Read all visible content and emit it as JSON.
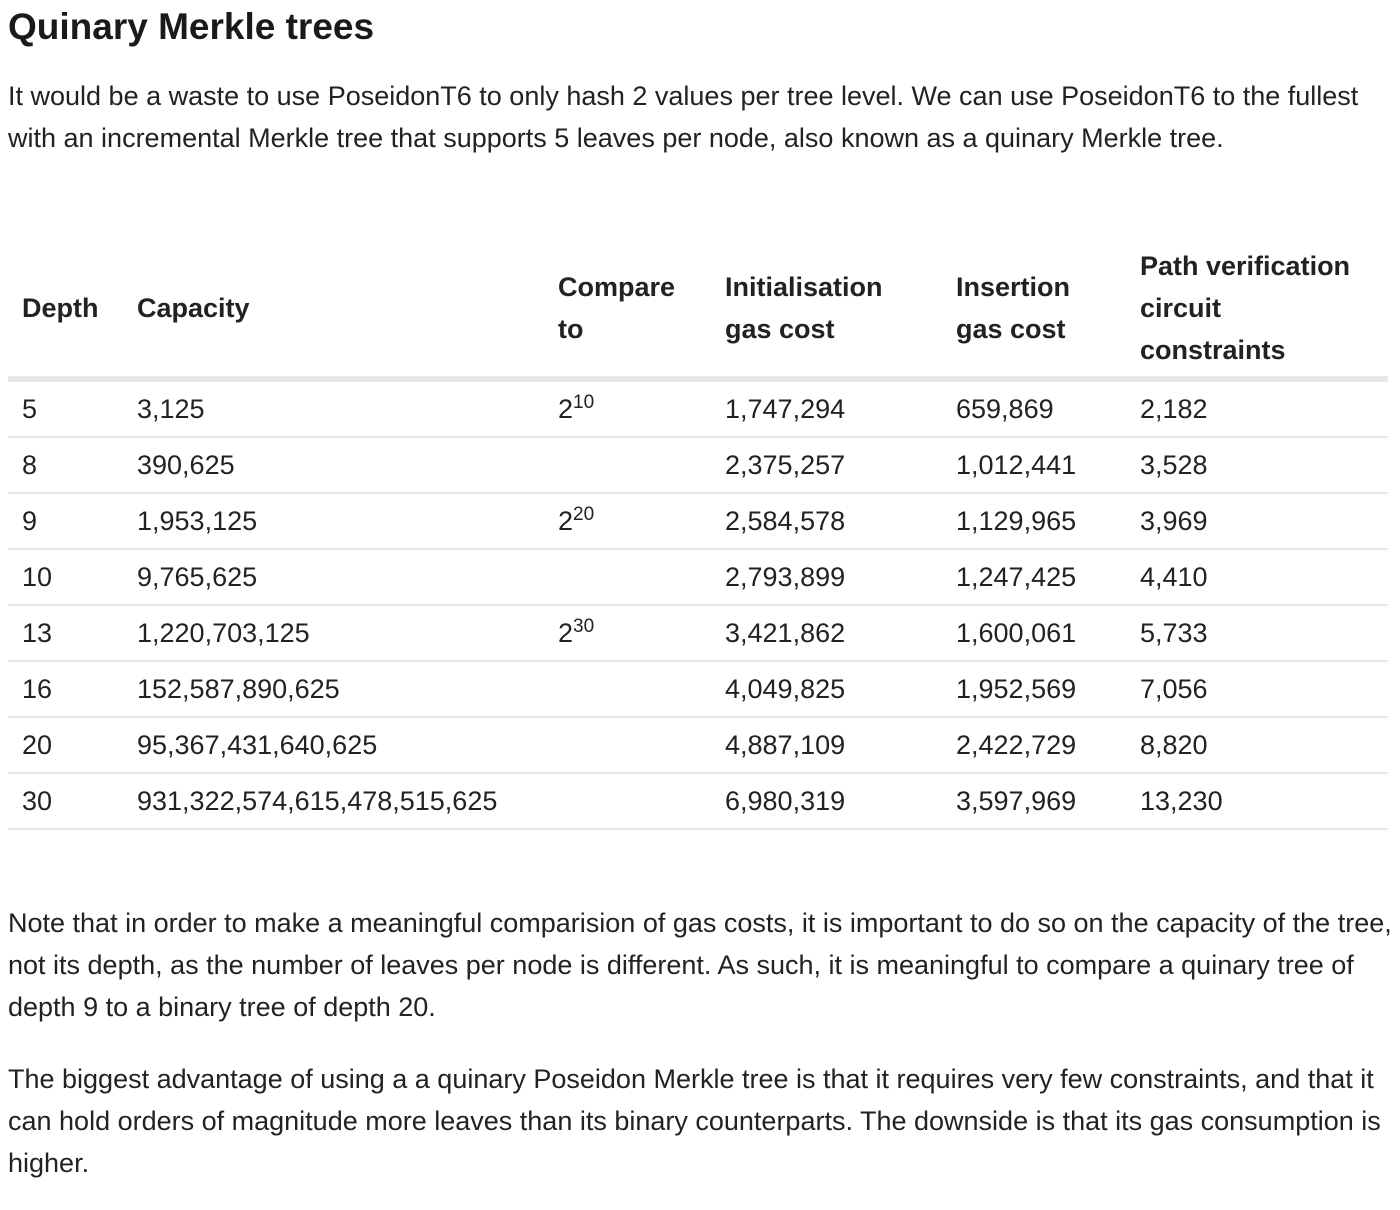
{
  "heading": "Quinary Merkle trees",
  "intro": "It would be a waste to use PoseidonT6 to only hash 2 values per tree level. We can use PoseidonT6 to the fullest with an incremental Merkle tree that supports 5 leaves per node, also known as a quinary Merkle tree.",
  "table": {
    "headers": {
      "depth": "Depth",
      "capacity": "Capacity",
      "compare": "Compare to",
      "init_gas": "Initialisation gas cost",
      "insert_gas": "Insertion gas cost",
      "path_constraints": "Path verification circuit constraints"
    },
    "rows": [
      {
        "depth": "5",
        "capacity": "3,125",
        "compare_base": "2",
        "compare_exp": "10",
        "init_gas": "1,747,294",
        "insert_gas": "659,869",
        "constraints": "2,182"
      },
      {
        "depth": "8",
        "capacity": "390,625",
        "compare_base": "",
        "compare_exp": "",
        "init_gas": "2,375,257",
        "insert_gas": "1,012,441",
        "constraints": "3,528"
      },
      {
        "depth": "9",
        "capacity": "1,953,125",
        "compare_base": "2",
        "compare_exp": "20",
        "init_gas": "2,584,578",
        "insert_gas": "1,129,965",
        "constraints": "3,969"
      },
      {
        "depth": "10",
        "capacity": "9,765,625",
        "compare_base": "",
        "compare_exp": "",
        "init_gas": "2,793,899",
        "insert_gas": "1,247,425",
        "constraints": "4,410"
      },
      {
        "depth": "13",
        "capacity": "1,220,703,125",
        "compare_base": "2",
        "compare_exp": "30",
        "init_gas": "3,421,862",
        "insert_gas": "1,600,061",
        "constraints": "5,733"
      },
      {
        "depth": "16",
        "capacity": "152,587,890,625",
        "compare_base": "",
        "compare_exp": "",
        "init_gas": "4,049,825",
        "insert_gas": "1,952,569",
        "constraints": "7,056"
      },
      {
        "depth": "20",
        "capacity": "95,367,431,640,625",
        "compare_base": "",
        "compare_exp": "",
        "init_gas": "4,887,109",
        "insert_gas": "2,422,729",
        "constraints": "8,820"
      },
      {
        "depth": "30",
        "capacity": "931,322,574,615,478,515,625",
        "compare_base": "",
        "compare_exp": "",
        "init_gas": "6,980,319",
        "insert_gas": "3,597,969",
        "constraints": "13,230"
      }
    ]
  },
  "note1": "Note that in order to make a meaningful comparision of gas costs, it is important to do so on the capacity of the tree, not its depth, as the number of leaves per node is different. As such, it is meaningful to compare a quinary tree of depth 9 to a binary tree of depth 20.",
  "note2": "The biggest advantage of using a a quinary Poseidon Merkle tree is that it requires very few constraints, and that it can hold orders of magnitude more leaves than its binary counterparts. The downside is that its gas consumption is higher."
}
